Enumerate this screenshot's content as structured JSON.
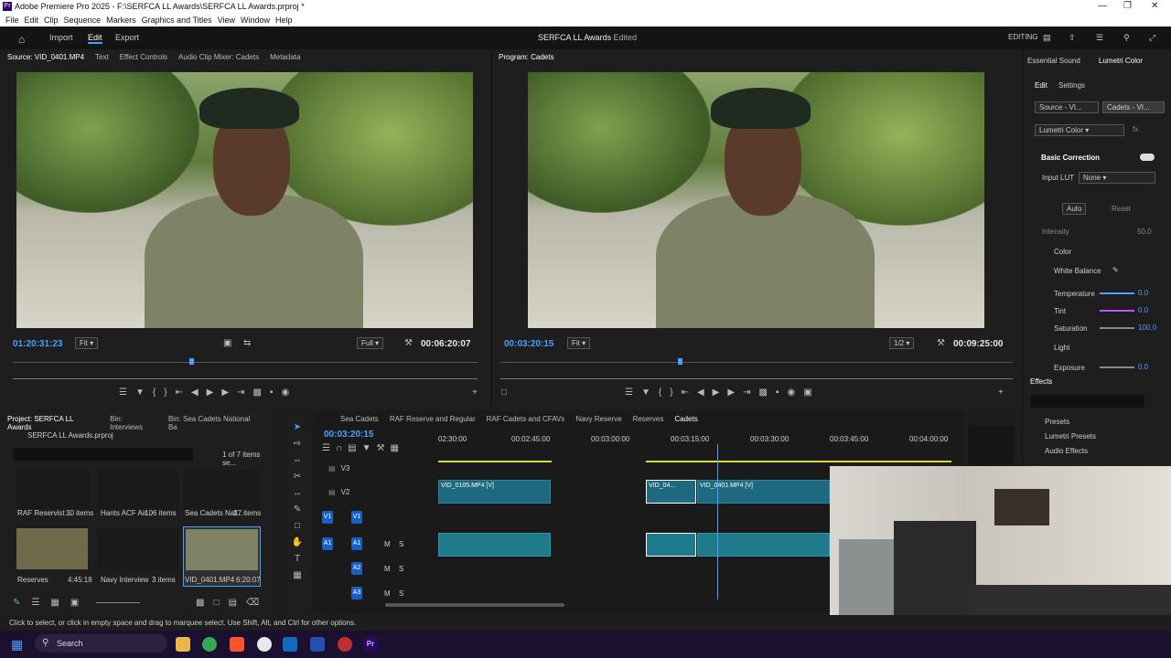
{
  "window": {
    "title": "Adobe Premiere Pro 2025 - F:\\SERFCA LL Awards\\SERFCA LL Awards.prproj *",
    "logo": "Pr"
  },
  "menu": [
    "File",
    "Edit",
    "Clip",
    "Sequence",
    "Markers",
    "Graphics and Titles",
    "View",
    "Window",
    "Help"
  ],
  "appbar": {
    "import": "Import",
    "edit": "Edit",
    "export": "Export",
    "project_title": "SERFCA LL Awards",
    "status": "- Edited",
    "workspace": "EDITING"
  },
  "source": {
    "tabs": [
      "Source: VID_0401.MP4",
      "Text",
      "Effect Controls",
      "Audio Clip Mixer: Cadets",
      "Metadata"
    ],
    "timecode": "01:20:31:23",
    "fit": "Fit",
    "quality": "Full",
    "duration": "00:06:20:07"
  },
  "program": {
    "tab": "Program: Cadets",
    "timecode": "00:03:20:15",
    "fit": "Fit",
    "quality": "1/2",
    "duration": "00:09:25:00"
  },
  "lumetri": {
    "tabs": [
      "Essential Sound",
      "Lumetri Color"
    ],
    "subtabs": [
      "Edit",
      "Settings"
    ],
    "source_btn": "Source - VI...",
    "target_btn": "Cadets - VI...",
    "effect_select": "Lumetri Color",
    "section": "Basic Correction",
    "input_lut_label": "Input LUT",
    "input_lut_value": "None",
    "auto": "Auto",
    "reset": "Reset",
    "intensity_label": "Intensity",
    "intensity_value": "50.0",
    "color_label": "Color",
    "white_balance": "White Balance",
    "params": [
      {
        "label": "Temperature",
        "value": "0.0",
        "color": "#4d9fff"
      },
      {
        "label": "Tint",
        "value": "0.0",
        "color": "#c04dff"
      },
      {
        "label": "Saturation",
        "value": "100.0",
        "color": "#4d9fff"
      }
    ],
    "light_label": "Light",
    "exposure_label": "Exposure",
    "exposure_value": "0.0"
  },
  "effects": {
    "title": "Effects",
    "items": [
      "Presets",
      "Lumetri Presets",
      "Audio Effects"
    ]
  },
  "project": {
    "tabs": [
      "Project: SERFCA LL Awards",
      "Bin: Interviews",
      "Bin: Sea Cadets National Ba"
    ],
    "file": "SERFCA LL Awards.prproj",
    "count": "1 of 7 items se...",
    "bins": [
      {
        "name": "RAF Reservist ...",
        "count": "30 items"
      },
      {
        "name": "Hants ACF Air...",
        "count": "106 items"
      },
      {
        "name": "Sea Cadets Nat...",
        "count": "37 items"
      }
    ],
    "bins2": [
      {
        "name": "Reserves",
        "count": "4:45:18"
      },
      {
        "name": "Navy Interview",
        "count": "3 items"
      },
      {
        "name": "VID_0401.MP4",
        "count": "6:20:07"
      }
    ]
  },
  "timeline": {
    "tabs": [
      "Sea Cadets",
      "RAF Reserve and Regular",
      "RAF Cadets and CFAVs",
      "Navy Reserve",
      "Reserves",
      "Cadets"
    ],
    "timecode": "00:03:20:15",
    "ruler": [
      "02:30:00",
      "00:02:45:00",
      "00:03:00:00",
      "00:03:15:00",
      "00:03:30:00",
      "00:03:45:00",
      "00:04:00:00"
    ],
    "tracks": [
      "V3",
      "V2",
      "V1",
      "A1",
      "A2",
      "A3"
    ],
    "clips": {
      "v2a": "VID_0105.MP4 [V]",
      "v2b": "VID_04...",
      "v2c": "VID_0401.MP4 [V]"
    },
    "toggle_m": "M",
    "toggle_s": "S"
  },
  "status_text": "Click to select, or click in empty space and drag to marquee select. Use Shift, Alt, and Ctrl for other options.",
  "taskbar": {
    "search": "Search"
  }
}
